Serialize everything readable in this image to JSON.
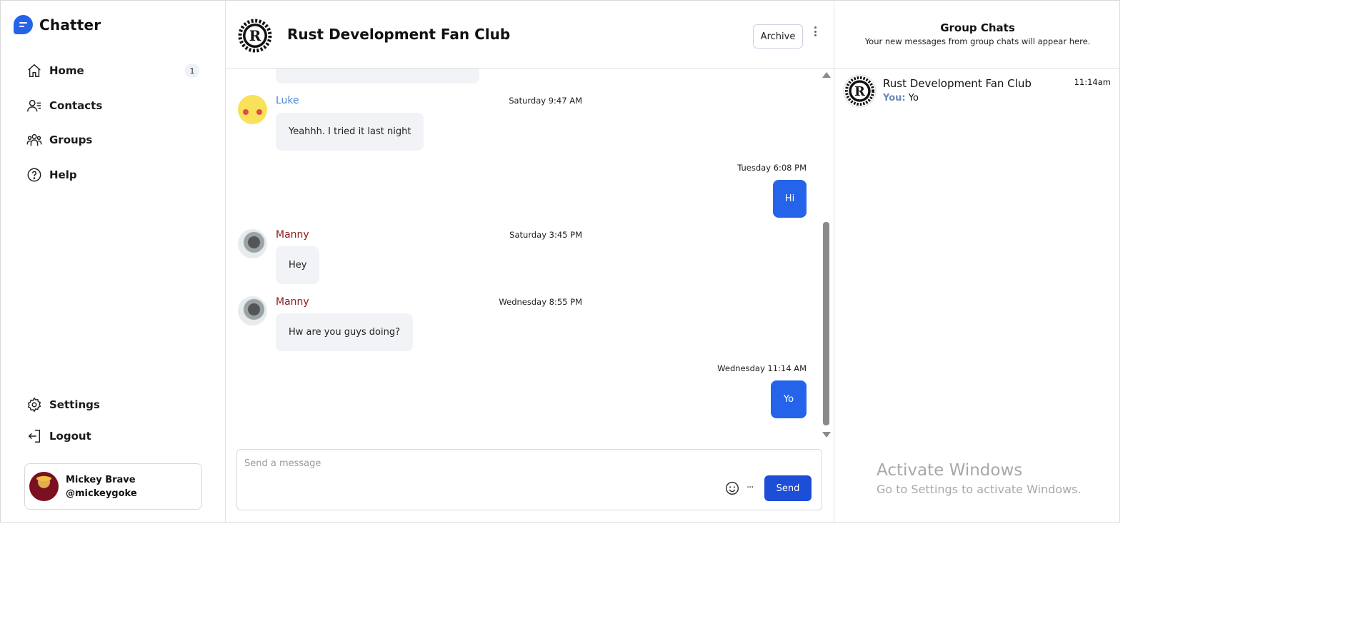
{
  "app": {
    "name": "Chatter",
    "accent": "#2563eb"
  },
  "sidebar": {
    "nav": [
      {
        "label": "Home",
        "badge": "1",
        "icon": "home-icon"
      },
      {
        "label": "Contacts",
        "icon": "contacts-icon"
      },
      {
        "label": "Groups",
        "icon": "groups-icon"
      },
      {
        "label": "Help",
        "icon": "help-icon"
      }
    ],
    "bottom": [
      {
        "label": "Settings",
        "icon": "gear-icon"
      },
      {
        "label": "Logout",
        "icon": "logout-icon"
      }
    ],
    "user": {
      "name": "Mickey Brave",
      "handle": "@mickeygoke"
    }
  },
  "chat": {
    "title": "Rust Development Fan Club",
    "archive_label": "Archive",
    "messages": [
      {
        "sender": "Luke",
        "time": "Saturday 9:47 AM",
        "text": "Yeahhh. I tried it last night",
        "direction": "in"
      },
      {
        "time": "Tuesday 6:08 PM",
        "text": "Hi",
        "direction": "out"
      },
      {
        "sender": "Manny",
        "time": "Saturday 3:45 PM",
        "text": "Hey",
        "direction": "in"
      },
      {
        "sender": "Manny",
        "time": "Wednesday 8:55 PM",
        "text": "Hw are you guys doing?",
        "direction": "in"
      },
      {
        "time": "Wednesday 11:14 AM",
        "text": "Yo",
        "direction": "out"
      }
    ],
    "composer": {
      "placeholder": "Send a message",
      "more": "...",
      "send_label": "Send"
    }
  },
  "group_panel": {
    "title": "Group Chats",
    "subtitle": "Your new messages from group chats will appear here.",
    "items": [
      {
        "name": "Rust Development Fan Club",
        "you_prefix": "You:",
        "preview": "Yo",
        "time": "11:14am"
      }
    ]
  },
  "watermark": {
    "title": "Activate Windows",
    "subtitle": "Go to Settings to activate Windows."
  }
}
